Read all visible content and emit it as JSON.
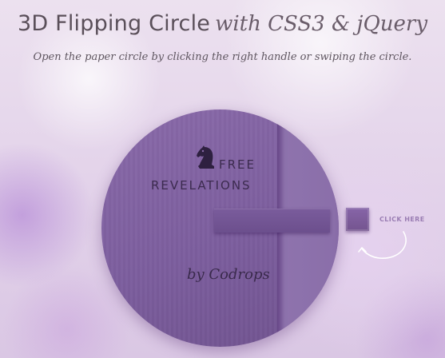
{
  "header": {
    "title_main": "3D Flipping Circle",
    "title_script": "with CSS3 & jQuery",
    "subtitle": "Open the paper circle by clicking the right handle or swiping the circle."
  },
  "circle": {
    "logo_icon": "chess-knight-icon",
    "line1": "FREE",
    "line2": "REVELATIONS",
    "signature": "by Codrops"
  },
  "handle": {
    "hint": "CLICK HERE",
    "arrow_icon": "curved-arrow-icon"
  },
  "colors": {
    "circle": "#7d5f9f",
    "handle": "#7a5a9c",
    "text_dark": "#3c2b4f",
    "hint": "#9a7db3"
  }
}
